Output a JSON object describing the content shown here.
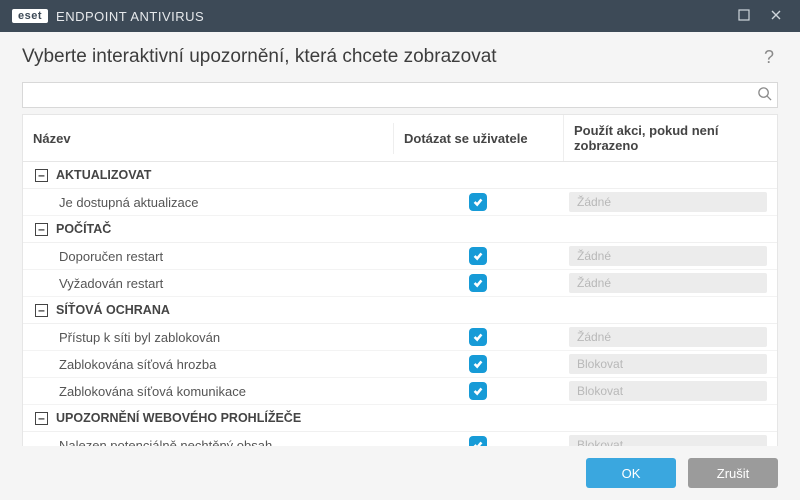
{
  "titlebar": {
    "brand_badge": "eset",
    "product_name": "ENDPOINT ANTIVIRUS"
  },
  "header": {
    "title": "Vyberte interaktivní upozornění, která chcete zobrazovat",
    "help_symbol": "?"
  },
  "search": {
    "value": "",
    "placeholder": ""
  },
  "columns": {
    "name": "Název",
    "ask": "Dotázat se uživatele",
    "action": "Použít akci, pokud není zobrazeno"
  },
  "groups": [
    {
      "label": "AKTUALIZOVAT",
      "expanded": true,
      "items": [
        {
          "name": "Je dostupná aktualizace",
          "ask": true,
          "action": "Žádné"
        }
      ]
    },
    {
      "label": "POČÍTAČ",
      "expanded": true,
      "items": [
        {
          "name": "Doporučen restart",
          "ask": true,
          "action": "Žádné"
        },
        {
          "name": "Vyžadován restart",
          "ask": true,
          "action": "Žádné"
        }
      ]
    },
    {
      "label": "SÍŤOVÁ OCHRANA",
      "expanded": true,
      "items": [
        {
          "name": "Přístup k síti byl zablokován",
          "ask": true,
          "action": "Žádné"
        },
        {
          "name": "Zablokována síťová hrozba",
          "ask": true,
          "action": "Blokovat"
        },
        {
          "name": "Zablokována síťová komunikace",
          "ask": true,
          "action": "Blokovat"
        }
      ]
    },
    {
      "label": "UPOZORNĚNÍ WEBOVÉHO PROHLÍŽEČE",
      "expanded": true,
      "items": [
        {
          "name": "Nalezen potenciálně nechtěný obsah",
          "ask": true,
          "action": "Blokovat"
        }
      ]
    }
  ],
  "footer": {
    "ok": "OK",
    "cancel": "Zrušit"
  },
  "colors": {
    "titlebar": "#3d4a57",
    "accent": "#179bd7",
    "primary_btn": "#3aa7df",
    "secondary_btn": "#9b9b9b"
  }
}
